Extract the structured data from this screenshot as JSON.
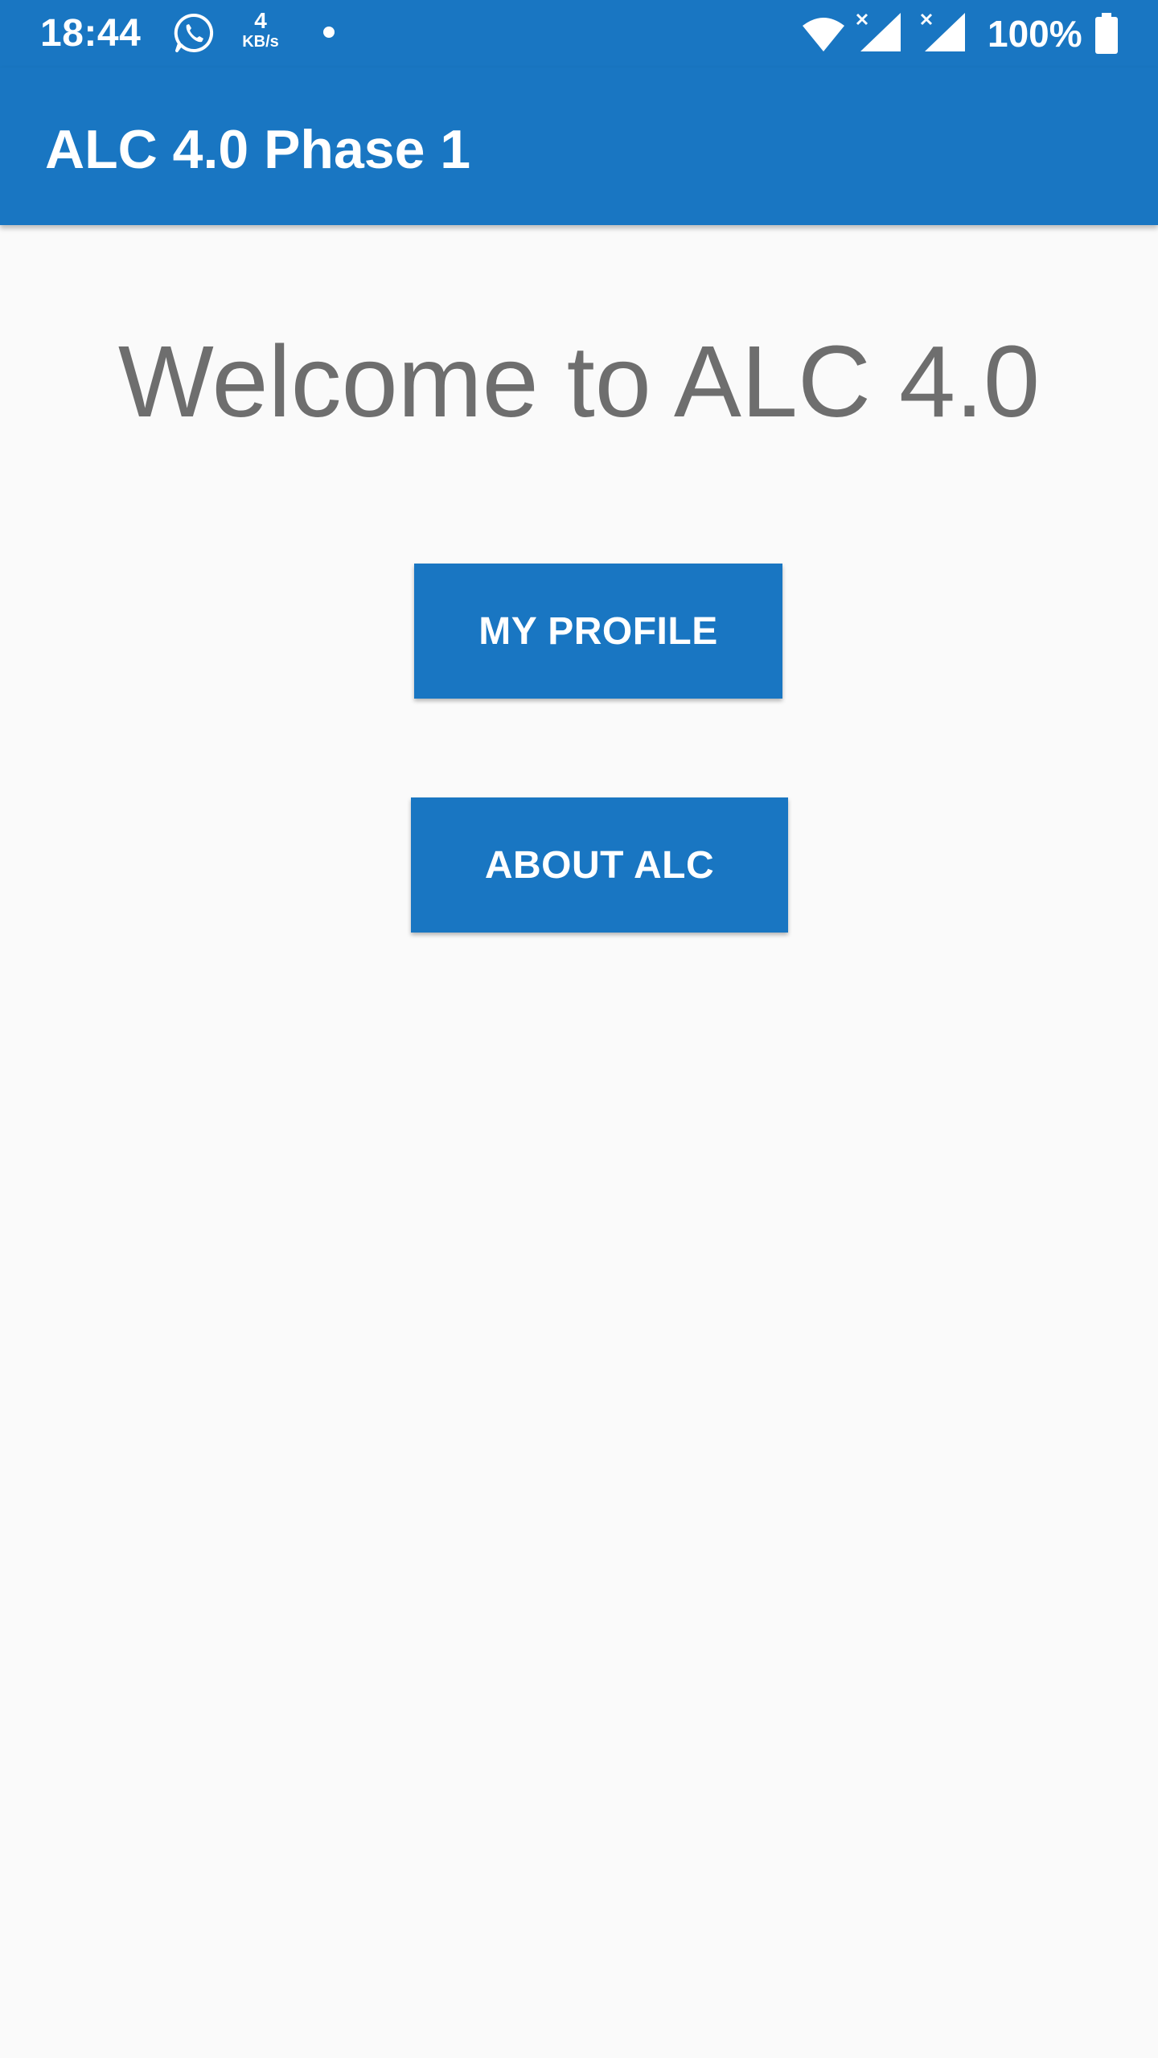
{
  "status_bar": {
    "time": "18:44",
    "network_speed_value": "4",
    "network_speed_unit": "KB/s",
    "battery_text": "100%",
    "icons": [
      "whatsapp-icon",
      "notification-dot-icon",
      "wifi-icon",
      "signal-icon",
      "signal-icon",
      "battery-icon"
    ]
  },
  "app_bar": {
    "title": "ALC 4.0 Phase 1"
  },
  "main": {
    "welcome_text": "Welcome to ALC 4.0",
    "buttons": {
      "profile_label": "MY PROFILE",
      "about_label": "ABOUT ALC"
    }
  },
  "colors": {
    "primary": "#1976c2",
    "background": "#fafafa",
    "heading_text": "#6e6e6e",
    "on_primary": "#ffffff"
  }
}
